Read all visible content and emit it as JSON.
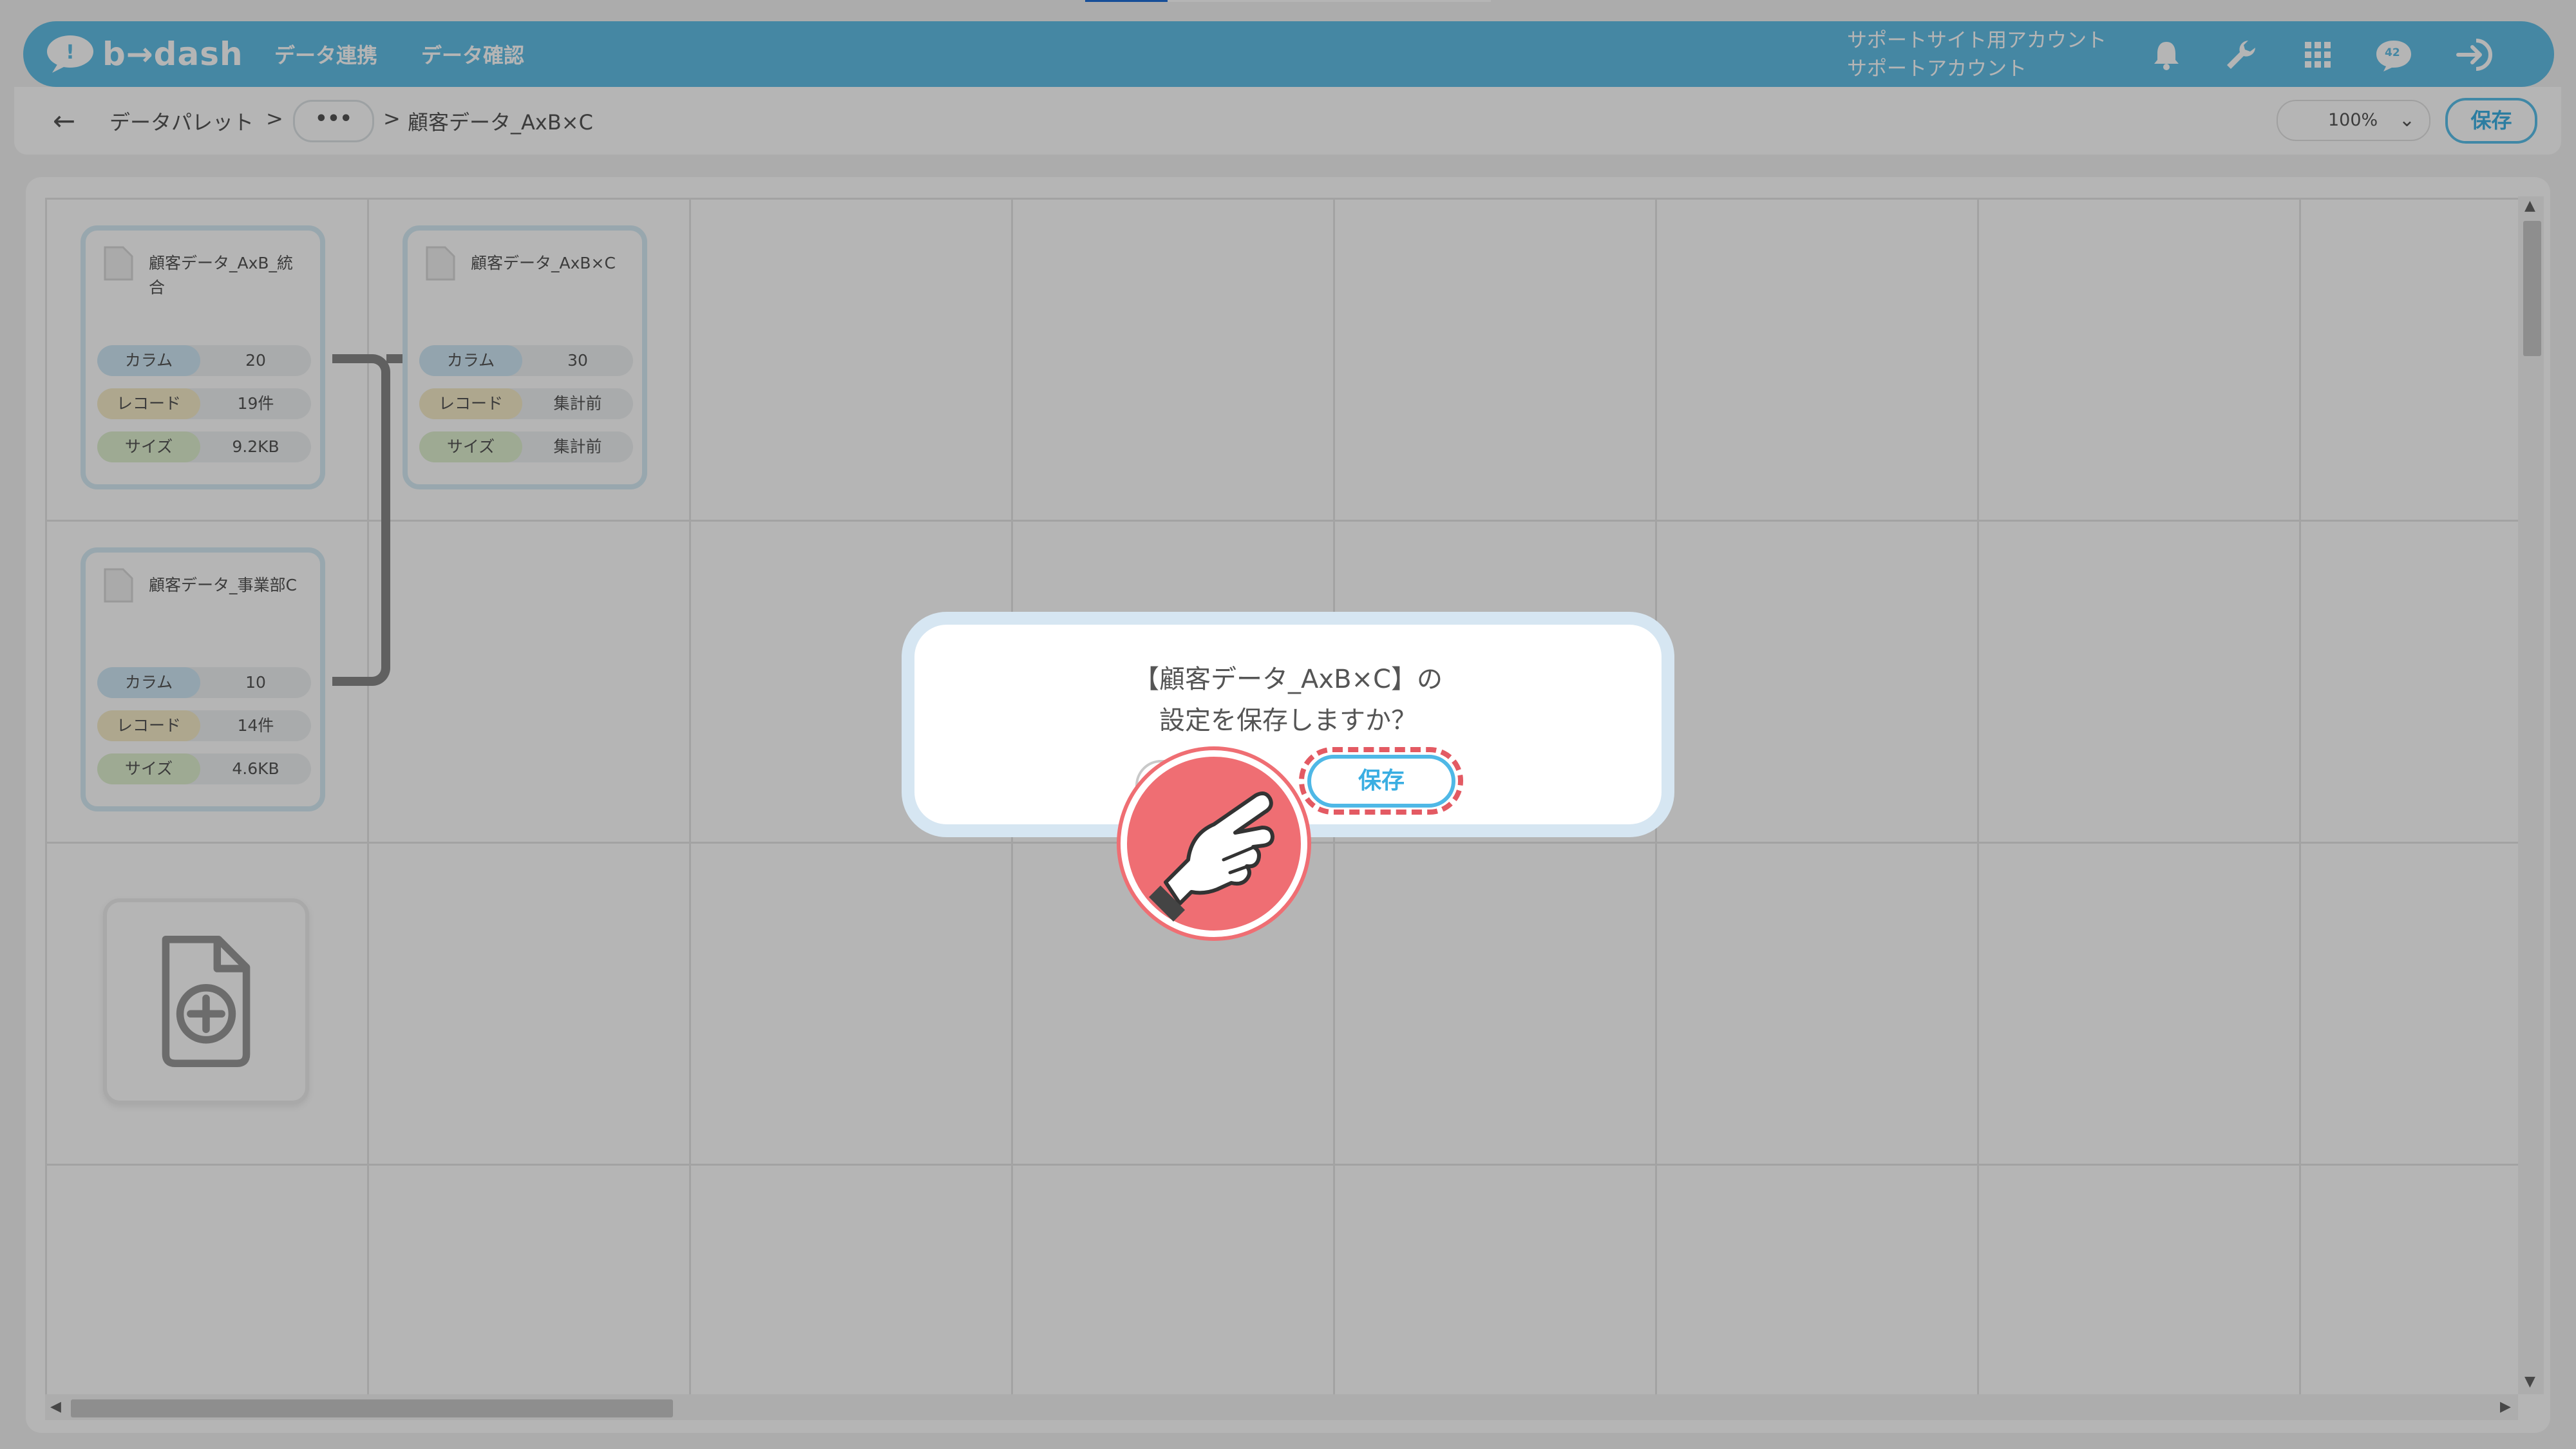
{
  "header": {
    "logo_text": "b→dash",
    "nav": [
      "データ連携",
      "データ確認"
    ],
    "account_line1": "サポートサイト用アカウント",
    "account_line2": "サポートアカウント",
    "badge": "42",
    "accent_color": "#62bfe6"
  },
  "breadcrumb": {
    "root": "データパレット",
    "sep1": ">",
    "ellipsis": "•••",
    "sep2": ">",
    "current": "顧客データ_AxB×C"
  },
  "toolbar": {
    "zoom": "100%",
    "save_label": "保存"
  },
  "canvas": {
    "cards": [
      {
        "title": "顧客データ_AxB_統合",
        "rows": [
          {
            "label": "カラム",
            "value": "20"
          },
          {
            "label": "レコード",
            "value": "19件"
          },
          {
            "label": "サイズ",
            "value": "9.2KB"
          }
        ]
      },
      {
        "title": "顧客データ_AxB×C",
        "rows": [
          {
            "label": "カラム",
            "value": "30"
          },
          {
            "label": "レコード",
            "value": "集計前"
          },
          {
            "label": "サイズ",
            "value": "集計前"
          }
        ]
      },
      {
        "title": "顧客データ_事業部C",
        "rows": [
          {
            "label": "カラム",
            "value": "10"
          },
          {
            "label": "レコード",
            "value": "14件"
          },
          {
            "label": "サイズ",
            "value": "4.6KB"
          }
        ]
      }
    ]
  },
  "dialog": {
    "line1": "【顧客データ_AxB×C】の",
    "line2": "設定を保存しますか？",
    "save_label": "保存",
    "highlight_color": "#e35a63"
  }
}
